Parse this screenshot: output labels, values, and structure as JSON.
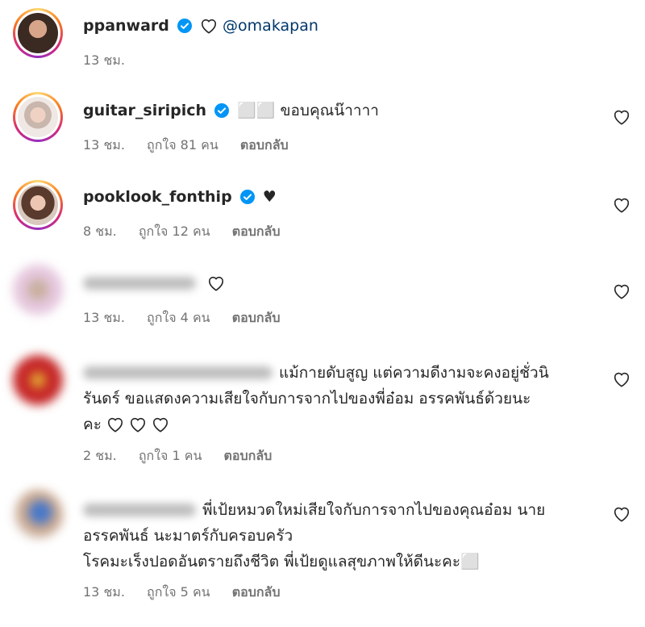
{
  "comments": [
    {
      "username": "ppanward",
      "verified": true,
      "mention": "@omakapan",
      "time": "13 ชม."
    },
    {
      "username": "guitar_siripich",
      "verified": true,
      "text": "⬜⬜ ขอบคุณน๊าาาา",
      "time": "13 ชม.",
      "likes": "ถูกใจ 81 คน",
      "reply": "ตอบกลับ"
    },
    {
      "username": "pooklook_fonthip",
      "verified": true,
      "text": "♥",
      "time": "8 ชม.",
      "likes": "ถูกใจ 12 คน",
      "reply": "ตอบกลับ"
    },
    {
      "time": "13 ชม.",
      "likes": "ถูกใจ 4 คน",
      "reply": "ตอบกลับ"
    },
    {
      "lines": [
        "แม้กายดับสูญ แต่ความดีงามจะคงอยู่ชั่วนิ",
        "รันดร์ ขอแสดงความเสียใจกับการจากไปของพี่อ๋อม อรรคพันธ์ด้วยนะ",
        "คะ"
      ],
      "time": "2 ชม.",
      "likes": "ถูกใจ 1 คน",
      "reply": "ตอบกลับ"
    },
    {
      "lines": [
        "พี่เป้ยหมวดใหม่เสียใจกับการจากไปของคุณอ๋อม นาย",
        "อรรคพันธ์ นะมาตร์กับครอบครัว",
        "โรคมะเร็งปอดอันตรายถึงชีวิต พี่เป้ยดูแลสุขภาพให้ดีนะคะ⬜"
      ],
      "time": "13 ชม.",
      "likes": "ถูกใจ 5 คน",
      "reply": "ตอบกลับ"
    }
  ],
  "colors": {
    "verified": "#0095f6",
    "meta": "#737373",
    "mention": "#00376b"
  }
}
